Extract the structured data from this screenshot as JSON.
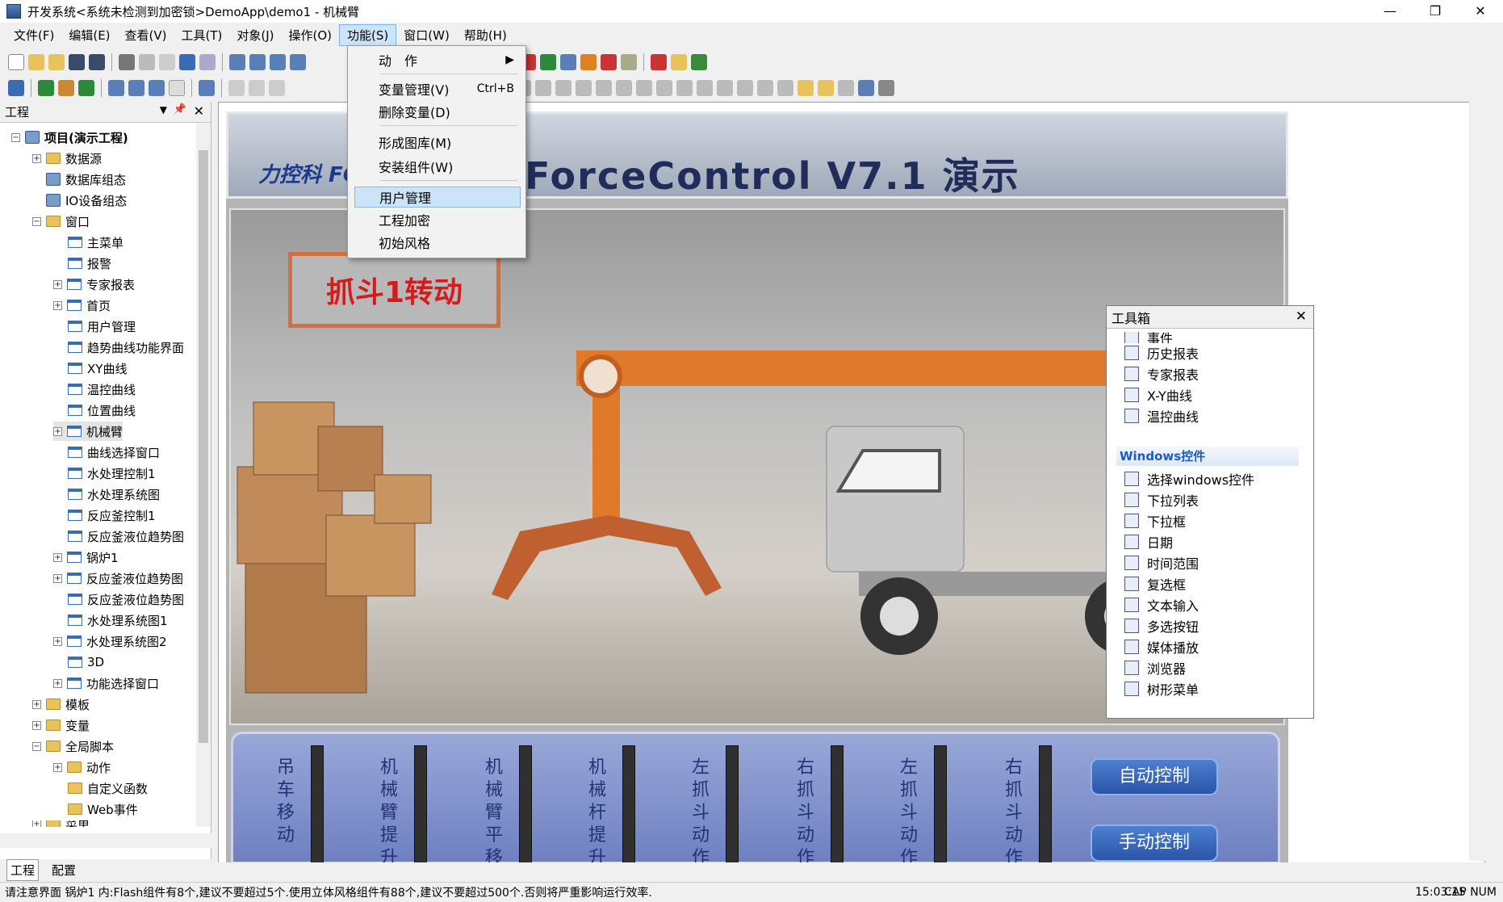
{
  "window": {
    "title": "开发系统<系统未检测到加密锁>DemoApp\\demo1 - 机械臂",
    "controls": [
      "—",
      "❐",
      "✕"
    ]
  },
  "menubar": [
    "文件(F)",
    "编辑(E)",
    "查看(V)",
    "工具(T)",
    "对象(J)",
    "操作(O)",
    "功能(S)",
    "窗口(W)",
    "帮助(H)"
  ],
  "dropdown": {
    "items": [
      {
        "label": "动　作",
        "shortcut": "▶"
      },
      {
        "label": "变量管理(V)",
        "shortcut": "Ctrl+B"
      },
      {
        "label": "删除变量(D)",
        "shortcut": ""
      },
      {
        "label": "形成图库(M)",
        "shortcut": ""
      },
      {
        "label": "安装组件(W)",
        "shortcut": ""
      },
      {
        "label": "用户管理",
        "shortcut": ""
      },
      {
        "label": "工程加密",
        "shortcut": ""
      },
      {
        "label": "初始风格",
        "shortcut": ""
      }
    ]
  },
  "project_panel": {
    "title": "工程",
    "tree": [
      "项目(演示工程)",
      "数据源",
      "数据库组态",
      "IO设备组态",
      "窗口",
      "主菜单",
      "报警",
      "专家报表",
      "首页",
      "用户管理",
      "趋势曲线功能界面",
      "XY曲线",
      "温控曲线",
      "位置曲线",
      "机械臂",
      "曲线选择窗口",
      "水处理控制1",
      "水处理系统图",
      "反应釜控制1",
      "反应釜液位趋势图",
      "锅炉1",
      "反应釜液位趋势图",
      "反应釜液位趋势图",
      "水处理系统图1",
      "水处理系统图2",
      "3D",
      "功能选择窗口",
      "模板",
      "变量",
      "全局脚本",
      "动作",
      "自定义函数",
      "Web事件",
      "菜单"
    ],
    "tabs": [
      "工程",
      "配置"
    ]
  },
  "hmi": {
    "title": "ForceControl V7.1 演示",
    "logo": "力控科 FORCEC",
    "sign": "抓斗1转动",
    "labels": [
      "吊车移动",
      "机械臂提升",
      "机械臂平移",
      "机械杆提升",
      "左抓斗动作",
      "右抓斗动作",
      "左抓斗动作",
      "右抓斗动作"
    ],
    "buttons": [
      "自动控制",
      "手动控制"
    ]
  },
  "toolbox": {
    "title": "工具箱",
    "top_items": [
      "事件",
      "历史报表",
      "专家报表",
      "X-Y曲线",
      "温控曲线"
    ],
    "section": "Windows控件",
    "windows_items": [
      "选择windows控件",
      "下拉列表",
      "下拉框",
      "日期",
      "时间范围",
      "复选框",
      "文本输入",
      "多选按钮",
      "媒体播放",
      "浏览器",
      "树形菜单"
    ]
  },
  "statusbar": {
    "message": "请注意界面 锅炉1 内:Flash组件有8个,建议不要超过5个.使用立体风格组件有88个,建议不要超过500个.否则将严重影响运行效率.",
    "time": "15:03:15",
    "caps": "CAP NUM"
  }
}
